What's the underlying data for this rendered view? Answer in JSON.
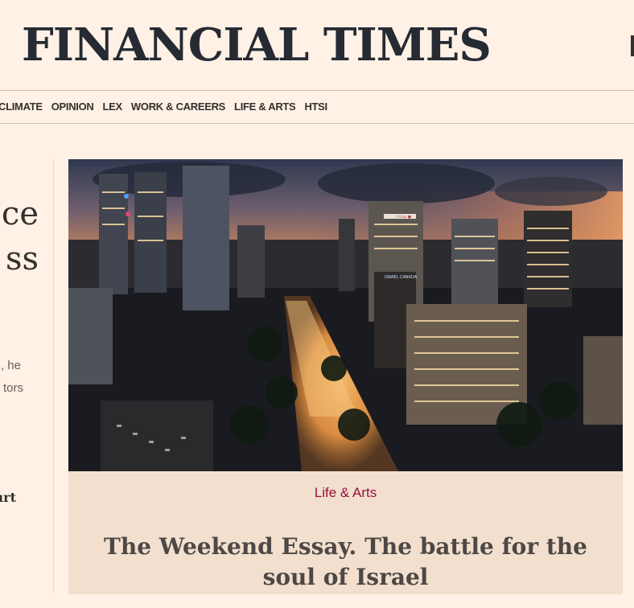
{
  "brand": {
    "name": "FINANCIAL TIMES"
  },
  "nav": {
    "items": [
      "CLIMATE",
      "OPINION",
      "LEX",
      "WORK & CAREERS",
      "LIFE & ARTS",
      "HTSI"
    ]
  },
  "left_column": {
    "headline_line1": "ce",
    "headline_line2": "ss",
    "body_line1": ", he",
    "body_line2": "tors",
    "link_text": "urt"
  },
  "feature": {
    "image_alt": "Aerial night view of Tel Aviv with crowds filling a street between tower blocks",
    "image_sign_1": "ISRAEL CANADA",
    "image_sign_2": "מגדלי ●",
    "section": "Life & Arts",
    "headline_bold": "The Weekend Essay.",
    "headline_rest": "The battle for the soul of Israel"
  },
  "colors": {
    "page_bg": "#fff1e5",
    "card_bg": "#f2dfce",
    "section_color": "#990f3d",
    "text_dark": "#33302e"
  }
}
